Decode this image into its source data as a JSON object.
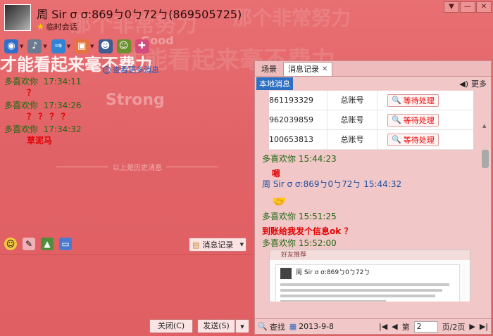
{
  "window": {
    "title": "周 Sir σ σ:869ㄅ0ㄅ72ㄅ(869505725)",
    "session_type": "临时会话",
    "controls": [
      "▼",
      "—",
      "✕"
    ]
  },
  "watermark": {
    "line1": "那个非常努力",
    "line2": "才能看起来毫不费力",
    "word1": "Good",
    "word2": "Strong"
  },
  "toolbar": {
    "items": [
      {
        "icon": "video-icon",
        "glyph": "◉",
        "color": "#2f6fc9"
      },
      {
        "icon": "microphone-icon",
        "glyph": "♪",
        "color": "#6b7a8f"
      },
      {
        "icon": "transfer-icon",
        "glyph": "⇒",
        "color": "#2f84d6"
      },
      {
        "icon": "screen-icon",
        "glyph": "▣",
        "color": "#e5743b"
      },
      {
        "icon": "contact-icon",
        "glyph": "☻",
        "color": "#3a5d92"
      },
      {
        "icon": "group-icon",
        "glyph": "☺",
        "color": "#6a8f2f"
      },
      {
        "icon": "add-friend-icon",
        "glyph": "✚",
        "color": "#d44c7a"
      }
    ]
  },
  "more_messages_link": "查看更多消息",
  "chat": {
    "messages": [
      {
        "sender": "多喜欢你",
        "time": "17:34:11",
        "text": "？"
      },
      {
        "sender": "多喜欢你",
        "time": "17:34:26",
        "text": "？ ？ ？ ？"
      },
      {
        "sender": "多喜欢你",
        "time": "17:34:32",
        "text": "草泥马"
      }
    ],
    "history_divider": "以上是历史消息"
  },
  "input_toolbar": {
    "message_record_button": "消息记录"
  },
  "buttons": {
    "close": "关闭(C)",
    "send": "发送(S)"
  },
  "right_panel": {
    "tabs": [
      {
        "label": "场景"
      },
      {
        "label": "消息记录"
      }
    ],
    "local_tag": "本地消息",
    "more": "更多",
    "records": [
      {
        "number": "861193329",
        "type": "总账号",
        "status": "等待处理"
      },
      {
        "number": "962039859",
        "type": "总账号",
        "status": "等待处理"
      },
      {
        "number": "100653813",
        "type": "总账号",
        "status": "等待处理"
      }
    ],
    "messages": [
      {
        "sender": "多喜欢你",
        "time": "15:44:23",
        "text": "嗯"
      },
      {
        "sender": "周 Sir σ σ:869ㄅ0ㄅ72ㄅ",
        "time": "15:44:32",
        "text": ""
      },
      {
        "sender": "多喜欢你",
        "time": "15:51:25",
        "text": "到账给我发个信息ok ？"
      },
      {
        "sender": "多喜欢你",
        "time": "15:52:00",
        "text": ""
      }
    ],
    "screenshot": {
      "header": "好友推荐",
      "name": "周 Sir σ σ:869ㄅ0ㄅ72ㄅ"
    },
    "footer": {
      "search": "查找",
      "date": "2013-9-8",
      "page_prefix": "第",
      "page_value": "2",
      "page_suffix": "页/2页"
    }
  }
}
